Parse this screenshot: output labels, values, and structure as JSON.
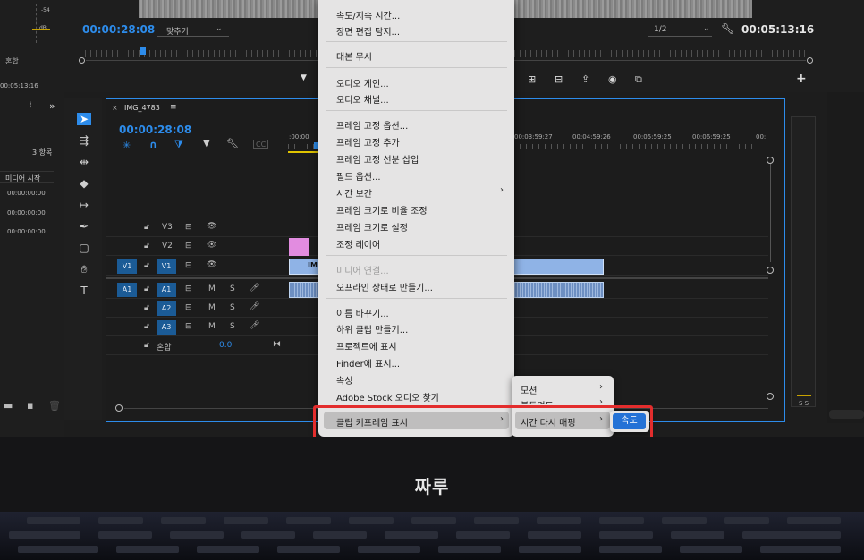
{
  "program_monitor": {
    "left_meter_label": "-54",
    "left_meter_db": "dB",
    "mix_label": "혼합",
    "left_timecode": "00:05:13:16",
    "current_timecode": "00:00:28:08",
    "fit_dropdown": "맞추기",
    "resolution_dropdown": "1/2",
    "duration_timecode": "00:05:13:16"
  },
  "project_panel": {
    "item_count": "3 항목",
    "column_header": "미디어 시작",
    "rows": [
      "00:00:00:00",
      "00:00:00:00",
      "00:00:00:00"
    ],
    "overflow_icon": "»"
  },
  "timeline": {
    "sequence_tab": "IMG_4783",
    "menu_icon": "≡",
    "close_icon": "×",
    "timecode": "00:00:28:08",
    "ruler_labels": [
      ":00:00",
      "00:03:59:27",
      "00:04:59:26",
      "00:05:59:25",
      "00:06:59:25",
      "00:"
    ],
    "tracks": [
      {
        "name": "V3",
        "type": "video"
      },
      {
        "name": "V2",
        "type": "video"
      },
      {
        "name": "V1",
        "type": "video",
        "source": "V1"
      },
      {
        "name": "A1",
        "type": "audio",
        "source": "A1",
        "m": "M",
        "s": "S"
      },
      {
        "name": "A2",
        "type": "audio",
        "m": "M",
        "s": "S"
      },
      {
        "name": "A3",
        "type": "audio",
        "m": "M",
        "s": "S"
      }
    ],
    "mix_label": "혼합",
    "mix_value": "0.0",
    "clip_label": "IM"
  },
  "meters": {
    "s_labels": "S S"
  },
  "context_menu": {
    "items": [
      {
        "label": "속도/지속 시간..."
      },
      {
        "label": "장면 편집 탐지..."
      },
      {
        "label": "대본 무시"
      },
      {
        "label": "오디오 게인..."
      },
      {
        "label": "오디오 채널..."
      },
      {
        "label": "프레임 고정 옵션..."
      },
      {
        "label": "프레임 고정 추가"
      },
      {
        "label": "프레임 고정 선분 삽입"
      },
      {
        "label": "필드 옵션..."
      },
      {
        "label": "시간 보간"
      },
      {
        "label": "프레임 크기로 비율 조정"
      },
      {
        "label": "프레임 크기로 설정"
      },
      {
        "label": "조정 레이어"
      },
      {
        "label": "미디어 연결..."
      },
      {
        "label": "오프라인 상태로 만들기..."
      },
      {
        "label": "이름 바꾸기..."
      },
      {
        "label": "하위 클립 만들기..."
      },
      {
        "label": "프로젝트에 표시"
      },
      {
        "label": "Finder에 표시..."
      },
      {
        "label": "속성"
      },
      {
        "label": "Adobe Stock 오디오 찾기"
      },
      {
        "label": "클립 키프레임 표시"
      }
    ],
    "chevron": "›"
  },
  "submenu_keyframes": {
    "items": [
      "모션",
      "불투명도",
      "시간 다시 매핑"
    ]
  },
  "submenu_time_remap": {
    "items": [
      "속도"
    ]
  },
  "device": {
    "brand": "짜루",
    "accent_color": "#2d8ceb",
    "highlight_color": "#e32d2d"
  }
}
